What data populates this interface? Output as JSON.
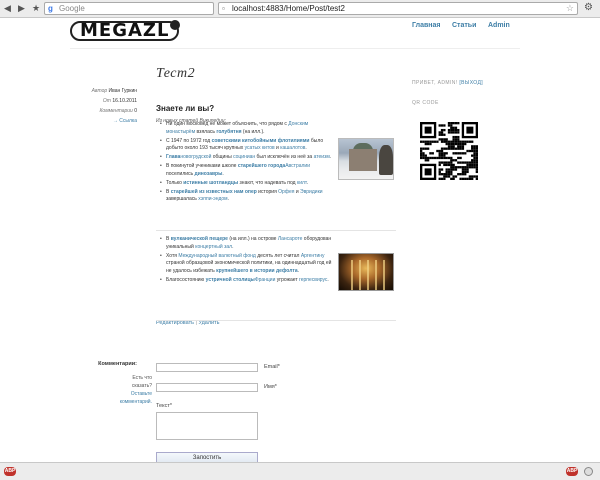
{
  "browser": {
    "search_placeholder": "Google",
    "url": "localhost:4883/Home/Post/test2",
    "back_icon": "back-arrow-icon",
    "forward_icon": "forward-arrow-icon"
  },
  "header": {
    "logo_text": "MEGAZL",
    "nav": [
      "Главная",
      "Статьи",
      "Admin"
    ]
  },
  "post": {
    "title": "Тест2",
    "meta": {
      "author_label": "Автор",
      "author": "Иван Гуркин",
      "date_label": "От",
      "date": "16.10.2011",
      "comments_label": "Комментарии",
      "comments_count": "0",
      "link_label": "→ Ссылка"
    },
    "heading": "Знаете ли вы?",
    "subheading": "Из новых статей Википедии:",
    "facts_group1": [
      [
        {
          "t": "Ни один московед не может объяснить, что рядом с "
        },
        {
          "t": "Донским монастырём",
          "c": "lnk"
        },
        {
          "t": " взялась "
        },
        {
          "t": "голубятня",
          "c": "lnkb"
        },
        {
          "t": " (на илл.)."
        }
      ],
      [
        {
          "t": "С 1947 по 1972 год "
        },
        {
          "t": "советскими китобойными флотилиями",
          "c": "lnkb"
        },
        {
          "t": " было добыто около 193 тысяч крупных "
        },
        {
          "t": "усатых китов",
          "c": "lnk"
        },
        {
          "t": " и "
        },
        {
          "t": "кашалотов",
          "c": "lnk"
        },
        {
          "t": "."
        }
      ],
      [
        {
          "t": "Глава",
          "c": "lnkb"
        },
        {
          "t": "новогрудской",
          "c": "lnk"
        },
        {
          "t": " общины "
        },
        {
          "t": "социниан",
          "c": "lnk"
        },
        {
          "t": " был исключён из неё за "
        },
        {
          "t": "атеизм",
          "c": "lnk"
        },
        {
          "t": "."
        }
      ],
      [
        {
          "t": "В покинутой учениками школе "
        },
        {
          "t": "старейшего города",
          "c": "lnkb"
        },
        {
          "t": "Австралии",
          "c": "lnk"
        },
        {
          "t": " поселились "
        },
        {
          "t": "динозавры",
          "c": "lnkb"
        },
        {
          "t": "."
        }
      ],
      [
        {
          "t": "Только "
        },
        {
          "t": "истинные шотландцы",
          "c": "lnkb"
        },
        {
          "t": " знают, что надевать под "
        },
        {
          "t": "килт",
          "c": "lnk"
        },
        {
          "t": "."
        }
      ],
      [
        {
          "t": "В "
        },
        {
          "t": "старейшей из известных нам опер",
          "c": "lnkb"
        },
        {
          "t": " история "
        },
        {
          "t": "Орфея",
          "c": "lnk"
        },
        {
          "t": " и "
        },
        {
          "t": "Эвридики",
          "c": "lnk"
        },
        {
          "t": " завершалась "
        },
        {
          "t": "хэппи-эндом",
          "c": "lnk"
        },
        {
          "t": "."
        }
      ]
    ],
    "facts_group2": [
      [
        {
          "t": "В "
        },
        {
          "t": "вулканической пещере",
          "c": "lnkb"
        },
        {
          "t": " (на илл.) на острове "
        },
        {
          "t": "Лансароте",
          "c": "lnk"
        },
        {
          "t": " оборудован уникальный "
        },
        {
          "t": "концертный зал",
          "c": "lnk"
        },
        {
          "t": "."
        }
      ],
      [
        {
          "t": "Хотя "
        },
        {
          "t": "Международный валютный фонд",
          "c": "lnk"
        },
        {
          "t": " десять лет считал "
        },
        {
          "t": "Аргентину",
          "c": "lnk"
        },
        {
          "t": " страной образцовой экономической политики, на одиннадцатый год ей не удалось избежать "
        },
        {
          "t": "крупнейшего в истории дефолта",
          "c": "lnkb"
        },
        {
          "t": "."
        }
      ],
      [
        {
          "t": "Благосостоянию "
        },
        {
          "t": "устричной столицы",
          "c": "lnkb"
        },
        {
          "t": "Франции",
          "c": "lnk"
        },
        {
          "t": " угрожает "
        },
        {
          "t": "герпесвирус",
          "c": "lnk"
        },
        {
          "t": "."
        }
      ]
    ],
    "edit_label": "Редактировать",
    "delete_label": "Удалить",
    "separator": "|"
  },
  "sidebar": {
    "greeting": "ПРИВЕТ, ",
    "user": "ADMIN!",
    "logout": "[ВЫХОД]",
    "qr_label": "QR CODE"
  },
  "comments": {
    "title": "Комментарии:",
    "help_text": "Есть что сказать?",
    "help_link": "Оставьте комментарий.",
    "email_label": "Email*",
    "name_label": "Имя*",
    "text_label": "Текст*",
    "submit_label": "Запостить"
  },
  "statusbar": {
    "abp_label": "ABP"
  },
  "colors": {
    "link": "#3d7ea6",
    "text": "#333333"
  }
}
